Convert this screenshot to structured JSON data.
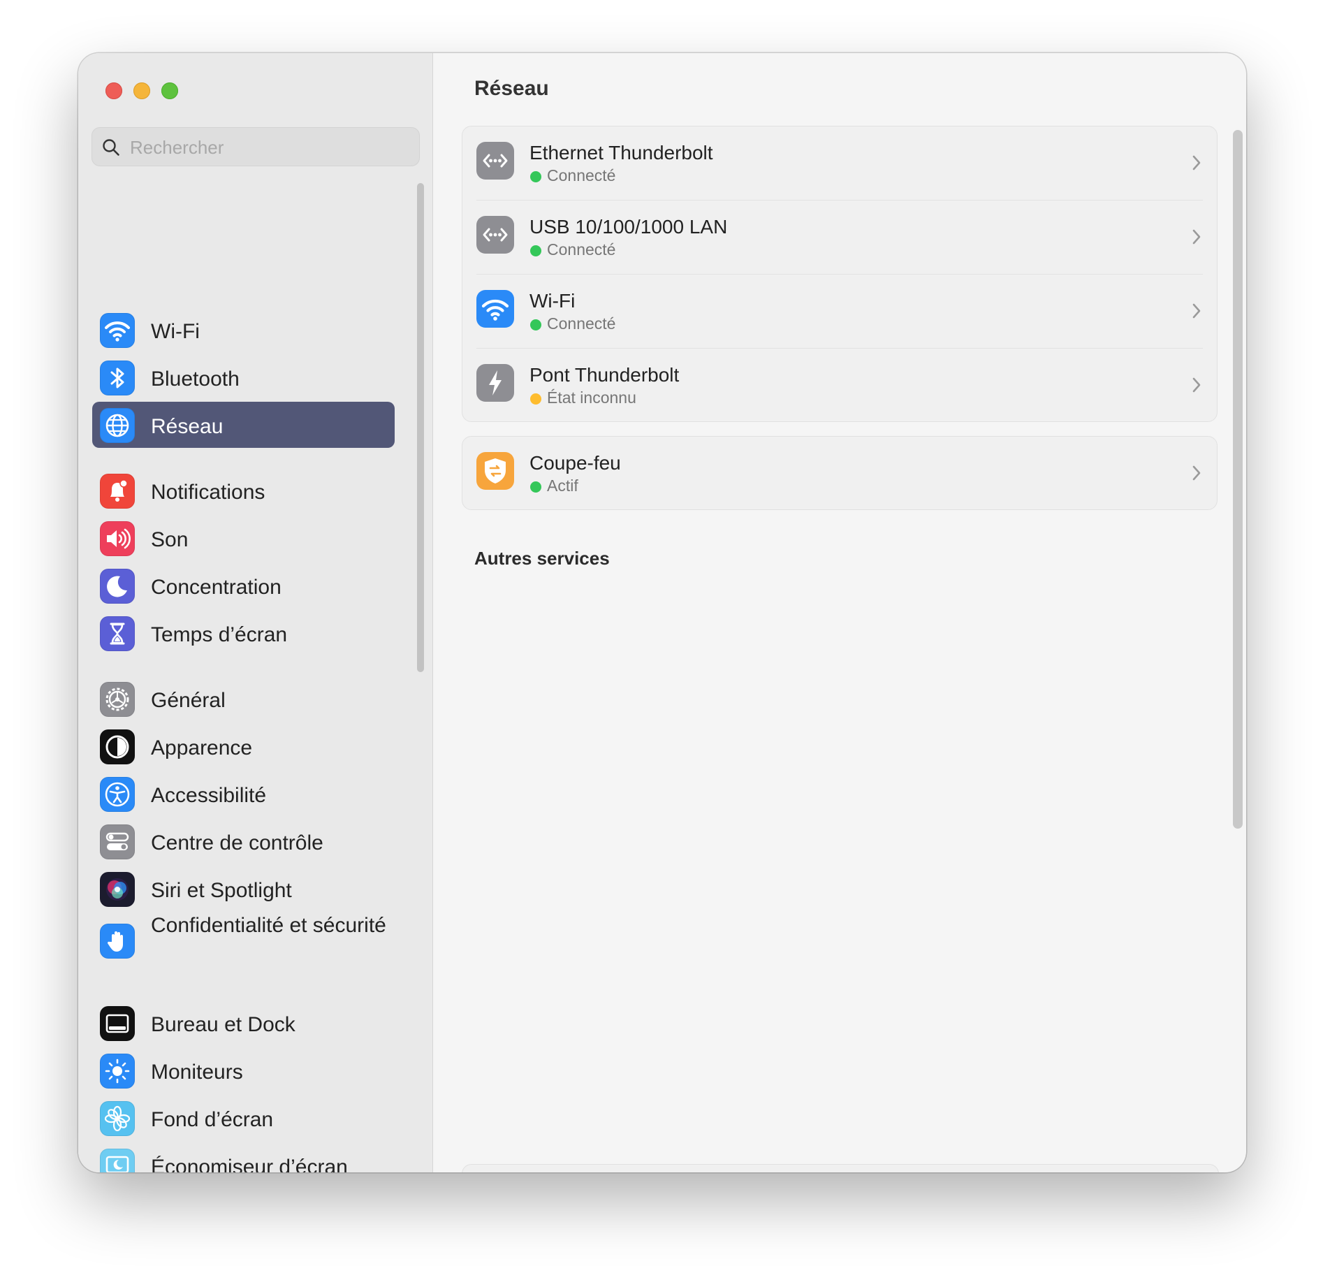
{
  "window": {
    "title": "Réseau"
  },
  "search": {
    "placeholder": "Rechercher",
    "value": ""
  },
  "sidebar": {
    "items": [
      {
        "label": "Wi-Fi",
        "icon": "wifi-icon"
      },
      {
        "label": "Bluetooth",
        "icon": "bluetooth-icon"
      },
      {
        "label": "Réseau",
        "icon": "globe-icon",
        "selected": true
      },
      {
        "label": "Notifications",
        "icon": "bell-icon"
      },
      {
        "label": "Son",
        "icon": "speaker-icon"
      },
      {
        "label": "Concentration",
        "icon": "moon-icon"
      },
      {
        "label": "Temps d’écran",
        "icon": "hourglass-icon"
      },
      {
        "label": "Général",
        "icon": "gear-icon"
      },
      {
        "label": "Apparence",
        "icon": "appearance-icon"
      },
      {
        "label": "Accessibilité",
        "icon": "accessibility-icon"
      },
      {
        "label": "Centre de contrôle",
        "icon": "toggles-icon"
      },
      {
        "label": "Siri et Spotlight",
        "icon": "siri-icon"
      },
      {
        "label": "Confidentialité et sécurité",
        "icon": "hand-icon"
      },
      {
        "label": "Bureau et Dock",
        "icon": "dock-icon"
      },
      {
        "label": "Moniteurs",
        "icon": "sun-icon"
      },
      {
        "label": "Fond d’écran",
        "icon": "flower-icon"
      },
      {
        "label": "Économiseur d’écran",
        "icon": "screensaver-icon"
      }
    ]
  },
  "main": {
    "title": "Réseau",
    "services": [
      {
        "name": "Ethernet Thunderbolt",
        "status": "Connecté",
        "status_color": "#34c759",
        "icon": "ethernet-icon"
      },
      {
        "name": "USB 10/100/1000 LAN",
        "status": "Connecté",
        "status_color": "#34c759",
        "icon": "ethernet-icon"
      },
      {
        "name": "Wi-Fi",
        "status": "Connecté",
        "status_color": "#34c759",
        "icon": "wifi-icon"
      },
      {
        "name": "Pont Thunderbolt",
        "status": "État inconnu",
        "status_color": "#febc2e",
        "icon": "thunderbolt-icon"
      }
    ],
    "firewall": {
      "name": "Coupe-feu",
      "status": "Actif",
      "status_color": "#34c759",
      "icon": "firewall-shield-icon"
    },
    "other_services_title": "Autres services"
  },
  "colors": {
    "accent_selection": "#525777",
    "sidebar_bg": "#e9e9e9",
    "content_bg": "#f5f5f5",
    "status_green": "#34c759",
    "status_yellow": "#febc2e"
  }
}
